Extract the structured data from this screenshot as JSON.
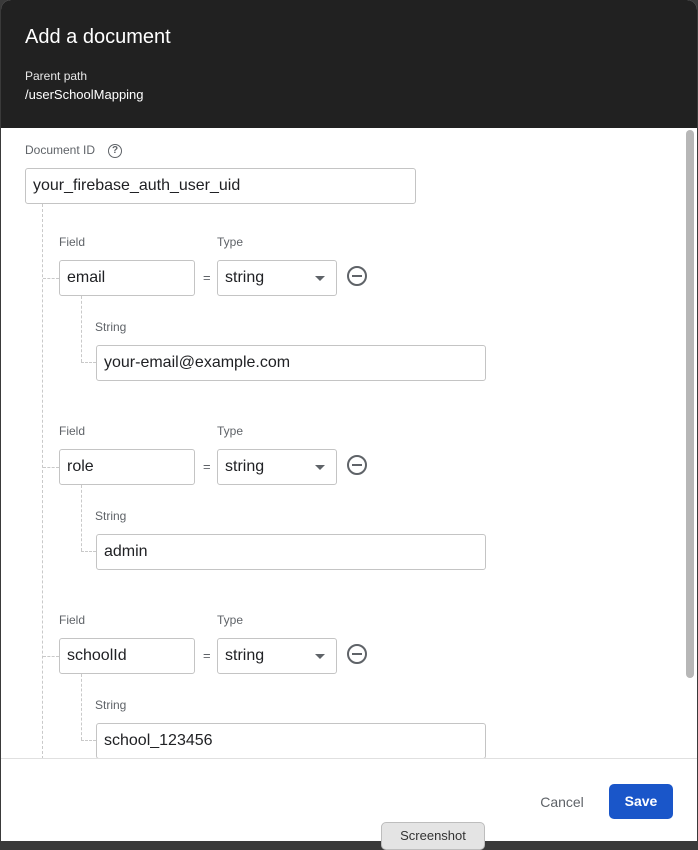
{
  "dialog": {
    "title": "Add a document",
    "parent_path_label": "Parent path",
    "parent_path_value": "/userSchoolMapping"
  },
  "document_id": {
    "label": "Document ID",
    "value": "your_firebase_auth_user_uid"
  },
  "fields": [
    {
      "field_label": "Field",
      "name": "email",
      "eq": "=",
      "type_label": "Type",
      "type": "string",
      "value_label": "String",
      "value": "your-email@example.com"
    },
    {
      "field_label": "Field",
      "name": "role",
      "eq": "=",
      "type_label": "Type",
      "type": "string",
      "value_label": "String",
      "value": "admin"
    },
    {
      "field_label": "Field",
      "name": "schoolId",
      "eq": "=",
      "type_label": "Type",
      "type": "string",
      "value_label": "String",
      "value": "school_123456"
    }
  ],
  "footer": {
    "cancel_label": "Cancel",
    "save_label": "Save"
  },
  "overlay": {
    "screenshot_label": "Screenshot"
  },
  "icons": {
    "help": "help-circle-icon",
    "remove": "remove-circle-icon",
    "dropdown": "caret-down-icon"
  },
  "colors": {
    "header_bg": "#212121",
    "save_bg": "#1a56c9"
  }
}
